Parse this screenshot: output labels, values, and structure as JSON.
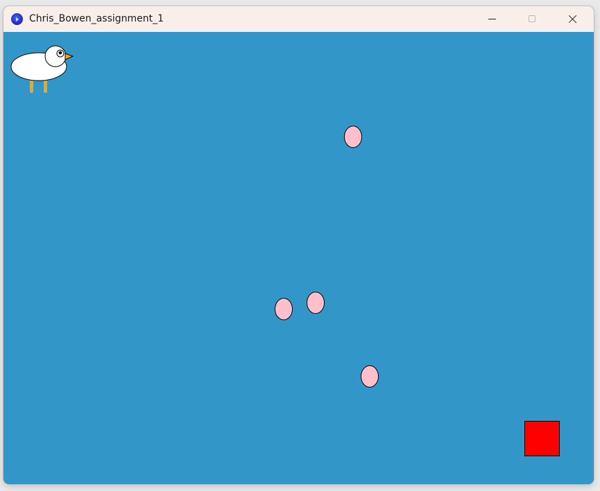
{
  "window": {
    "title": "Chris_Bowen_assignment_1",
    "controls": {
      "minimize": "minimize",
      "maximize": "maximize",
      "close": "close"
    }
  },
  "game": {
    "background_color": "#3396c9",
    "player": {
      "kind": "duck",
      "body_color": "#ffffff",
      "beak_color": "#f7a51a",
      "legs_color": "#f0a51a"
    },
    "eggs": {
      "count": 4,
      "fill_color": "#ffc0cb",
      "outline_color": "#000000"
    },
    "goal": {
      "shape": "square",
      "fill_color": "#ff0000"
    }
  }
}
